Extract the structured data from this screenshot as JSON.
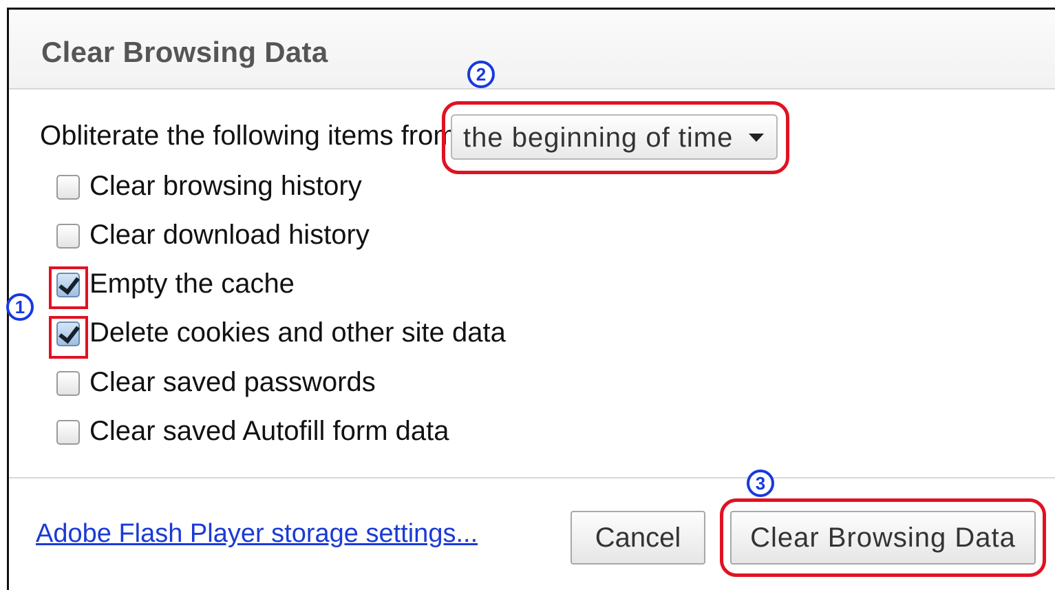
{
  "dialog": {
    "title": "Clear Browsing Data"
  },
  "time_range": {
    "label": "Obliterate the following items from:",
    "selected": "the beginning of time"
  },
  "options": [
    {
      "label": "Clear browsing history",
      "checked": false
    },
    {
      "label": "Clear download history",
      "checked": false
    },
    {
      "label": "Empty the cache",
      "checked": true
    },
    {
      "label": "Delete cookies and other site data",
      "checked": true
    },
    {
      "label": "Clear saved passwords",
      "checked": false
    },
    {
      "label": "Clear saved Autofill form data",
      "checked": false
    }
  ],
  "footer": {
    "flash_link": "Adobe Flash Player storage settings...",
    "cancel_label": "Cancel",
    "confirm_label": "Clear Browsing Data"
  },
  "annotations": {
    "step1": "1",
    "step2": "2",
    "step3": "3",
    "highlight_color": "#e01222",
    "marker_color": "#1739e0"
  }
}
